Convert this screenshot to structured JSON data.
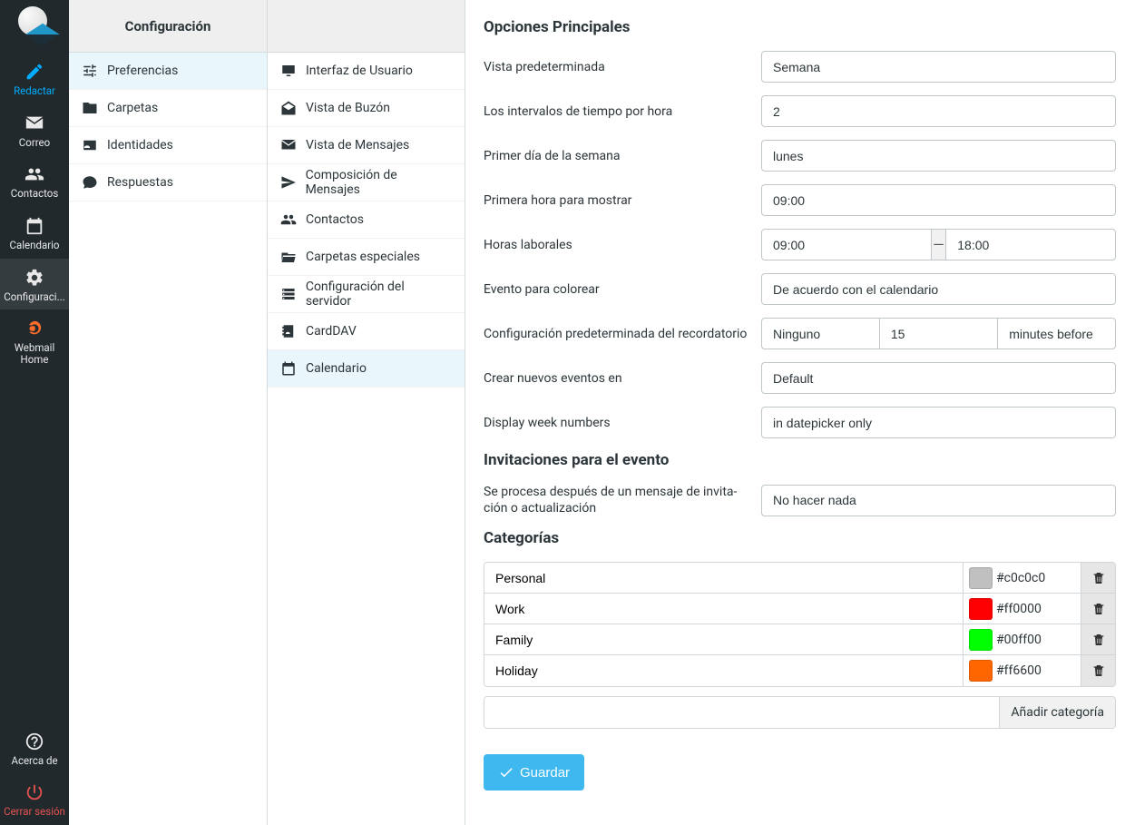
{
  "sidebar": {
    "items": [
      {
        "label": "Redactar"
      },
      {
        "label": "Correo"
      },
      {
        "label": "Contactos"
      },
      {
        "label": "Calendario"
      },
      {
        "label": "Configuraci..."
      },
      {
        "label": "Webmail Home"
      }
    ],
    "bottom": [
      {
        "label": "Acerca de"
      },
      {
        "label": "Cerrar sesión"
      }
    ]
  },
  "col1": {
    "header": "Configuración",
    "items": [
      {
        "label": "Preferencias"
      },
      {
        "label": "Carpetas"
      },
      {
        "label": "Identidades"
      },
      {
        "label": "Respuestas"
      }
    ]
  },
  "col2": {
    "items": [
      {
        "label": "Interfaz de Usuario"
      },
      {
        "label": "Vista de Buzón"
      },
      {
        "label": "Vista de Mensajes"
      },
      {
        "label": "Composición de Mensajes"
      },
      {
        "label": "Contactos"
      },
      {
        "label": "Carpetas especiales"
      },
      {
        "label": "Configuración del servidor"
      },
      {
        "label": "CardDAV"
      },
      {
        "label": "Calendario"
      }
    ]
  },
  "main": {
    "section1_title": "Opciones Principales",
    "default_view_label": "Vista predeterminada",
    "default_view_value": "Semana",
    "timeslots_label": "Los intervalos de tiempo por hora",
    "timeslots_value": "2",
    "firstday_label": "Primer día de la semana",
    "firstday_value": "lunes",
    "firsthour_label": "Primera hora para mostrar",
    "firsthour_value": "09:00",
    "workhours_label": "Horas laborales",
    "workhours_start": "09:00",
    "workhours_end": "18:00",
    "coloring_label": "Evento para colorear",
    "coloring_value": "De acuerdo con el calendario",
    "reminder_label": "Configuración predeterminada del recordatorio",
    "reminder_type": "Ninguno",
    "reminder_amount": "15",
    "reminder_unit": "minutes before",
    "newevents_label": "Crear nuevos eventos en",
    "newevents_value": "Default",
    "weeknums_label": "Display week numbers",
    "weeknums_value": "in datepicker only",
    "section2_title": "Invitaciones para el evento",
    "afterinvite_label": "Se procesa después de un mensaje de invita­ción o actualización",
    "afterinvite_value": "No hacer nada",
    "section3_title": "Categorías",
    "categories": [
      {
        "name": "Personal",
        "hex": "#c0c0c0"
      },
      {
        "name": "Work",
        "hex": "#ff0000"
      },
      {
        "name": "Family",
        "hex": "#00ff00"
      },
      {
        "name": "Holiday",
        "hex": "#ff6600"
      }
    ],
    "add_category_label": "Añadir categoría",
    "save_label": "Guardar"
  }
}
